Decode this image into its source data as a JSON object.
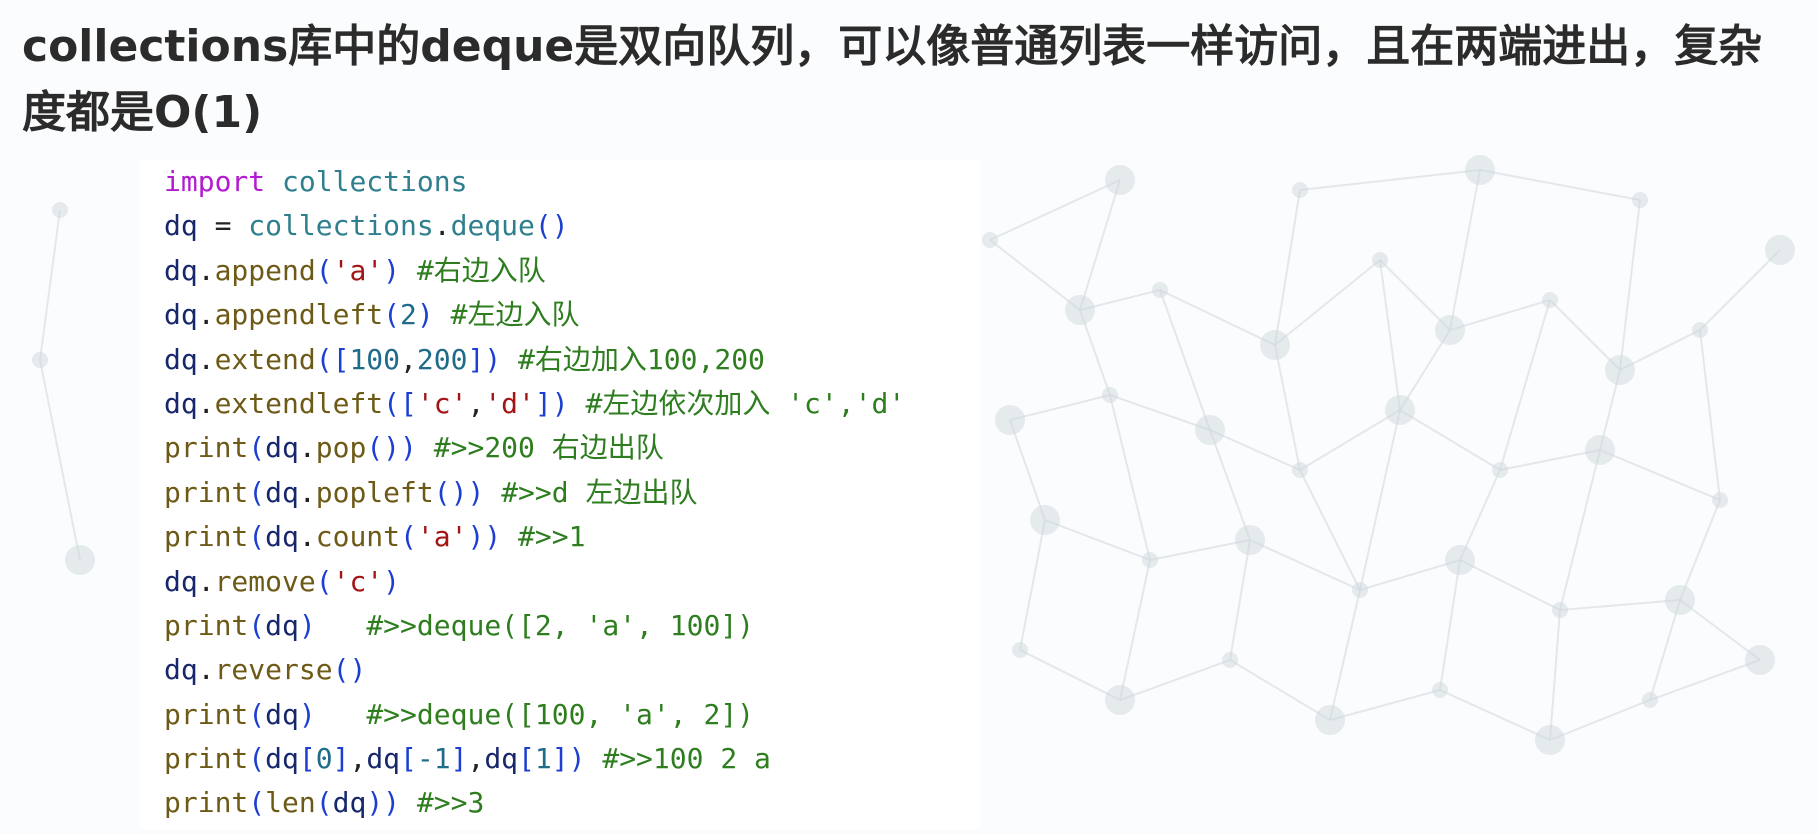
{
  "title": "collections库中的deque是双向队列，可以像普通列表一样访问，且在两端进出，复杂度都是O(1)",
  "colors": {
    "title": "#2b2b2b",
    "keyword": "#b31bd1",
    "module": "#2f7f8f",
    "variable": "#17276b",
    "function": "#6e5a17",
    "punctuation": "#1c3fd1",
    "string": "#a31515",
    "number": "#1f6b8a",
    "comment": "#2e7d1f",
    "background": "#fbfcfd",
    "network": "#cfd8de"
  },
  "code": {
    "language": "python",
    "lines": [
      [
        [
          "kw",
          "import"
        ],
        [
          "op",
          " "
        ],
        [
          "mod",
          "collections"
        ]
      ],
      [
        [
          "var",
          "dq"
        ],
        [
          "op",
          " = "
        ],
        [
          "mod",
          "collections"
        ],
        [
          "op",
          "."
        ],
        [
          "mod",
          "deque"
        ],
        [
          "punc",
          "()"
        ]
      ],
      [
        [
          "var",
          "dq"
        ],
        [
          "op",
          "."
        ],
        [
          "fn",
          "append"
        ],
        [
          "punc",
          "("
        ],
        [
          "str",
          "'a'"
        ],
        [
          "punc",
          ")"
        ],
        [
          "op",
          " "
        ],
        [
          "cm",
          "#右边入队"
        ]
      ],
      [
        [
          "var",
          "dq"
        ],
        [
          "op",
          "."
        ],
        [
          "fn",
          "appendleft"
        ],
        [
          "punc",
          "("
        ],
        [
          "num",
          "2"
        ],
        [
          "punc",
          ")"
        ],
        [
          "op",
          " "
        ],
        [
          "cm",
          "#左边入队"
        ]
      ],
      [
        [
          "var",
          "dq"
        ],
        [
          "op",
          "."
        ],
        [
          "fn",
          "extend"
        ],
        [
          "punc",
          "(["
        ],
        [
          "num",
          "100"
        ],
        [
          "op",
          ","
        ],
        [
          "num",
          "200"
        ],
        [
          "punc",
          "])"
        ],
        [
          "op",
          " "
        ],
        [
          "cm",
          "#右边加入100,200"
        ]
      ],
      [
        [
          "var",
          "dq"
        ],
        [
          "op",
          "."
        ],
        [
          "fn",
          "extendleft"
        ],
        [
          "punc",
          "(["
        ],
        [
          "str",
          "'c'"
        ],
        [
          "op",
          ","
        ],
        [
          "str",
          "'d'"
        ],
        [
          "punc",
          "])"
        ],
        [
          "op",
          " "
        ],
        [
          "cm",
          "#左边依次加入 'c','d'"
        ]
      ],
      [
        [
          "fn",
          "print"
        ],
        [
          "punc",
          "("
        ],
        [
          "var",
          "dq"
        ],
        [
          "op",
          "."
        ],
        [
          "fn",
          "pop"
        ],
        [
          "punc",
          "())"
        ],
        [
          "op",
          " "
        ],
        [
          "cm",
          "#>>200 右边出队"
        ]
      ],
      [
        [
          "fn",
          "print"
        ],
        [
          "punc",
          "("
        ],
        [
          "var",
          "dq"
        ],
        [
          "op",
          "."
        ],
        [
          "fn",
          "popleft"
        ],
        [
          "punc",
          "())"
        ],
        [
          "op",
          " "
        ],
        [
          "cm",
          "#>>d 左边出队"
        ]
      ],
      [
        [
          "fn",
          "print"
        ],
        [
          "punc",
          "("
        ],
        [
          "var",
          "dq"
        ],
        [
          "op",
          "."
        ],
        [
          "fn",
          "count"
        ],
        [
          "punc",
          "("
        ],
        [
          "str",
          "'a'"
        ],
        [
          "punc",
          "))"
        ],
        [
          "op",
          " "
        ],
        [
          "cm",
          "#>>1"
        ]
      ],
      [
        [
          "var",
          "dq"
        ],
        [
          "op",
          "."
        ],
        [
          "fn",
          "remove"
        ],
        [
          "punc",
          "("
        ],
        [
          "str",
          "'c'"
        ],
        [
          "punc",
          ")"
        ]
      ],
      [
        [
          "fn",
          "print"
        ],
        [
          "punc",
          "("
        ],
        [
          "var",
          "dq"
        ],
        [
          "punc",
          ")"
        ],
        [
          "op",
          "   "
        ],
        [
          "cm",
          "#>>deque([2, 'a', 100])"
        ]
      ],
      [
        [
          "var",
          "dq"
        ],
        [
          "op",
          "."
        ],
        [
          "fn",
          "reverse"
        ],
        [
          "punc",
          "()"
        ]
      ],
      [
        [
          "fn",
          "print"
        ],
        [
          "punc",
          "("
        ],
        [
          "var",
          "dq"
        ],
        [
          "punc",
          ")"
        ],
        [
          "op",
          "   "
        ],
        [
          "cm",
          "#>>deque([100, 'a', 2])"
        ]
      ],
      [
        [
          "fn",
          "print"
        ],
        [
          "punc",
          "("
        ],
        [
          "var",
          "dq"
        ],
        [
          "punc",
          "["
        ],
        [
          "num",
          "0"
        ],
        [
          "punc",
          "]"
        ],
        [
          "op",
          ","
        ],
        [
          "var",
          "dq"
        ],
        [
          "punc",
          "["
        ],
        [
          "num",
          "-1"
        ],
        [
          "punc",
          "]"
        ],
        [
          "op",
          ","
        ],
        [
          "var",
          "dq"
        ],
        [
          "punc",
          "["
        ],
        [
          "num",
          "1"
        ],
        [
          "punc",
          "])"
        ],
        [
          "op",
          " "
        ],
        [
          "cm",
          "#>>100 2 a"
        ]
      ],
      [
        [
          "fn",
          "print"
        ],
        [
          "punc",
          "("
        ],
        [
          "fn",
          "len"
        ],
        [
          "punc",
          "("
        ],
        [
          "var",
          "dq"
        ],
        [
          "punc",
          "))"
        ],
        [
          "op",
          " "
        ],
        [
          "cm",
          "#>>3"
        ]
      ]
    ]
  }
}
